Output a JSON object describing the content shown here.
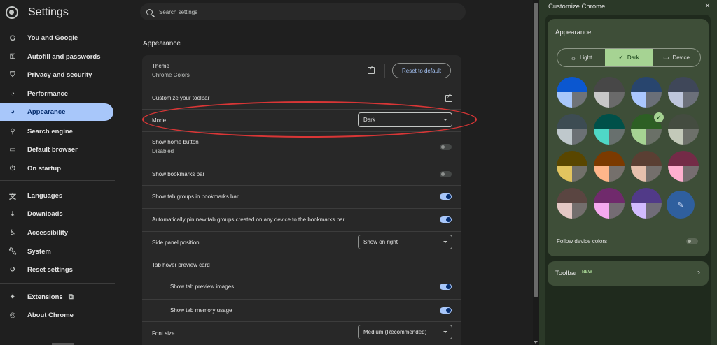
{
  "app": {
    "title": "Settings"
  },
  "search": {
    "placeholder": "Search settings"
  },
  "sidebar": {
    "items": [
      {
        "label": "You and Google",
        "icon": "google-g-icon"
      },
      {
        "label": "Autofill and passwords",
        "icon": "key-icon"
      },
      {
        "label": "Privacy and security",
        "icon": "shield-icon"
      },
      {
        "label": "Performance",
        "icon": "speedometer-icon"
      },
      {
        "label": "Appearance",
        "icon": "palette-icon",
        "active": true
      },
      {
        "label": "Search engine",
        "icon": "search-icon"
      },
      {
        "label": "Default browser",
        "icon": "browser-window-icon"
      },
      {
        "label": "On startup",
        "icon": "power-icon"
      },
      {
        "label": "Languages",
        "icon": "translate-icon"
      },
      {
        "label": "Downloads",
        "icon": "download-icon"
      },
      {
        "label": "Accessibility",
        "icon": "accessibility-icon"
      },
      {
        "label": "System",
        "icon": "wrench-icon"
      },
      {
        "label": "Reset settings",
        "icon": "reset-icon"
      },
      {
        "label": "Extensions",
        "icon": "puzzle-icon"
      },
      {
        "label": "About Chrome",
        "icon": "chrome-icon"
      }
    ]
  },
  "main": {
    "section_title": "Appearance",
    "theme": {
      "label": "Theme",
      "value": "Chrome Colors",
      "reset_label": "Reset to default"
    },
    "customize_toolbar": {
      "label": "Customize your toolbar"
    },
    "mode": {
      "label": "Mode",
      "value": "Dark"
    },
    "home_button": {
      "label": "Show home button",
      "value": "Disabled",
      "enabled": false
    },
    "bookmarks_bar": {
      "label": "Show bookmarks bar",
      "enabled": false
    },
    "tab_groups": {
      "label": "Show tab groups in bookmarks bar",
      "enabled": true
    },
    "auto_pin": {
      "label": "Automatically pin new tab groups created on any device to the bookmarks bar",
      "enabled": true
    },
    "side_panel": {
      "label": "Side panel position",
      "value": "Show on right"
    },
    "hover_card": {
      "label": "Tab hover preview card"
    },
    "preview_images": {
      "label": "Show tab preview images",
      "enabled": true
    },
    "memory_usage": {
      "label": "Show tab memory usage",
      "enabled": true
    },
    "font_size": {
      "label": "Font size",
      "value": "Medium (Recommended)"
    }
  },
  "panel": {
    "title": "Customize Chrome",
    "appearance_title": "Appearance",
    "modes": [
      {
        "label": "Light",
        "icon": "sun-icon",
        "selected": false
      },
      {
        "label": "Dark",
        "icon": "check-icon",
        "selected": true
      },
      {
        "label": "Device",
        "icon": "laptop-icon",
        "selected": false
      }
    ],
    "swatches": [
      {
        "tl": "#0b57d0",
        "bl": "#a8c7fa",
        "br": "#6f7378"
      },
      {
        "tl": "#474747",
        "bl": "#c7c7c7",
        "br": "#6a6a6a"
      },
      {
        "tl": "#28456e",
        "bl": "#aac7ff",
        "br": "#6a6f78"
      },
      {
        "tl": "#3f4759",
        "bl": "#bec6dc",
        "br": "#6c707a"
      },
      {
        "tl": "#3d4c53",
        "bl": "#bfc8cc",
        "br": "#6b7074"
      },
      {
        "tl": "#005049",
        "bl": "#4fd8c7",
        "br": "#68706e"
      },
      {
        "tl": "#2d5f24",
        "bl": "#a6d393",
        "br": "#6a7067",
        "selected": true
      },
      {
        "tl": "#444c40",
        "bl": "#c3c9b9",
        "br": "#6d706a"
      },
      {
        "tl": "#594600",
        "bl": "#e2c45f",
        "br": "#71706a"
      },
      {
        "tl": "#7b3a00",
        "bl": "#ffb68a",
        "br": "#75706c"
      },
      {
        "tl": "#5a3f33",
        "bl": "#e6c0ad",
        "br": "#746f6c"
      },
      {
        "tl": "#742b47",
        "bl": "#ffafcf",
        "br": "#766d70"
      },
      {
        "tl": "#5a4541",
        "bl": "#e4c8c4",
        "br": "#736e6d"
      },
      {
        "tl": "#702a6c",
        "bl": "#f5a9ef",
        "br": "#746c73"
      },
      {
        "tl": "#513a88",
        "bl": "#d2bbff",
        "br": "#706c78"
      }
    ],
    "custom_color_icon": "eyedropper-icon",
    "follow_device_label": "Follow device colors",
    "follow_device_enabled": false,
    "toolbar_label": "Toolbar",
    "toolbar_badge": "NEW"
  }
}
